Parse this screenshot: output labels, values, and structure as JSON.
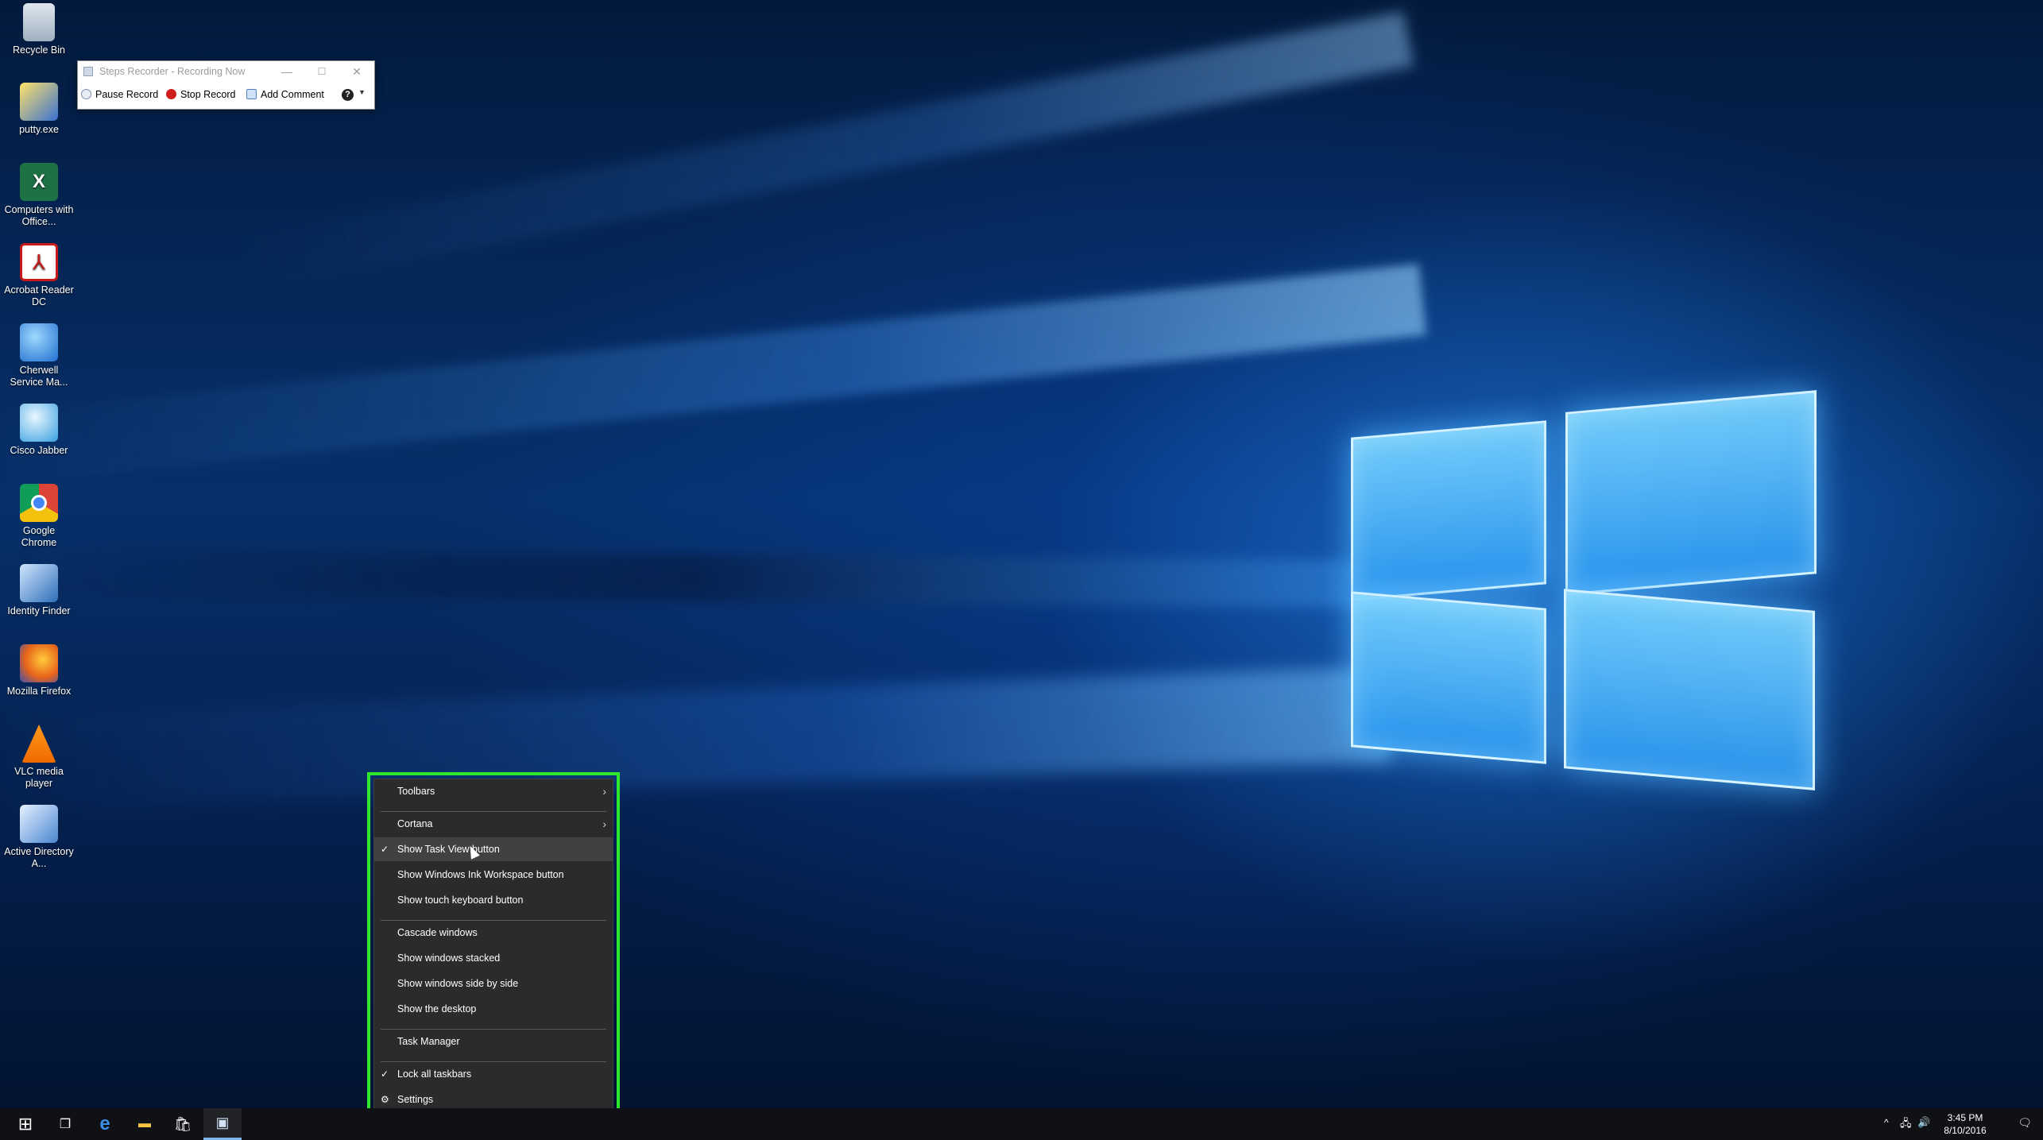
{
  "desktop": {
    "icons": [
      {
        "label": "Recycle Bin",
        "icon": "recycle-bin-icon"
      },
      {
        "label": "putty.exe",
        "icon": "putty-icon"
      },
      {
        "label": "Computers with Office...",
        "icon": "excel-icon",
        "glyph": "X"
      },
      {
        "label": "Acrobat Reader DC",
        "icon": "acrobat-icon",
        "glyph": "⅄"
      },
      {
        "label": "Cherwell Service Ma...",
        "icon": "cherwell-icon"
      },
      {
        "label": "Cisco Jabber",
        "icon": "cisco-jabber-icon"
      },
      {
        "label": "Google Chrome",
        "icon": "chrome-icon"
      },
      {
        "label": "Identity Finder",
        "icon": "identity-finder-icon"
      },
      {
        "label": "Mozilla Firefox",
        "icon": "firefox-icon"
      },
      {
        "label": "VLC media player",
        "icon": "vlc-icon"
      },
      {
        "label": "Active Directory A...",
        "icon": "active-directory-icon"
      }
    ]
  },
  "steps_recorder": {
    "title": "Steps Recorder - Recording Now",
    "minimize": "—",
    "maximize": "☐",
    "close": "✕",
    "pause_label": "Pause Record",
    "stop_label": "Stop Record",
    "comment_label": "Add Comment",
    "help": "?",
    "dropdown": "▼"
  },
  "context_menu": {
    "items": [
      {
        "label": "Toolbars",
        "arrow": "›"
      },
      {
        "label": "Cortana",
        "arrow": "›"
      },
      {
        "label": "Show Task View button",
        "check": "✓"
      },
      {
        "label": "Show Windows Ink Workspace button"
      },
      {
        "label": "Show touch keyboard button"
      },
      {
        "label": "Cascade windows"
      },
      {
        "label": "Show windows stacked"
      },
      {
        "label": "Show windows side by side"
      },
      {
        "label": "Show the desktop"
      },
      {
        "label": "Task Manager"
      },
      {
        "label": "Lock all taskbars",
        "check": "✓"
      },
      {
        "label": "Settings",
        "icon": "⚙"
      }
    ]
  },
  "taskbar": {
    "start": "⊞",
    "task_view": "❐",
    "edge": "e",
    "explorer": "▬",
    "store": "🛍",
    "steps_recorder": "▣"
  },
  "tray": {
    "chevron": "^",
    "network": "🖧",
    "volume": "🔊",
    "time": "3:45 PM",
    "date": "8/10/2016",
    "action_center": "🗨"
  },
  "colors": {
    "menu_bg": "#2b2b2b",
    "highlight": "#2ee82e",
    "taskbar": "#0f1114"
  }
}
